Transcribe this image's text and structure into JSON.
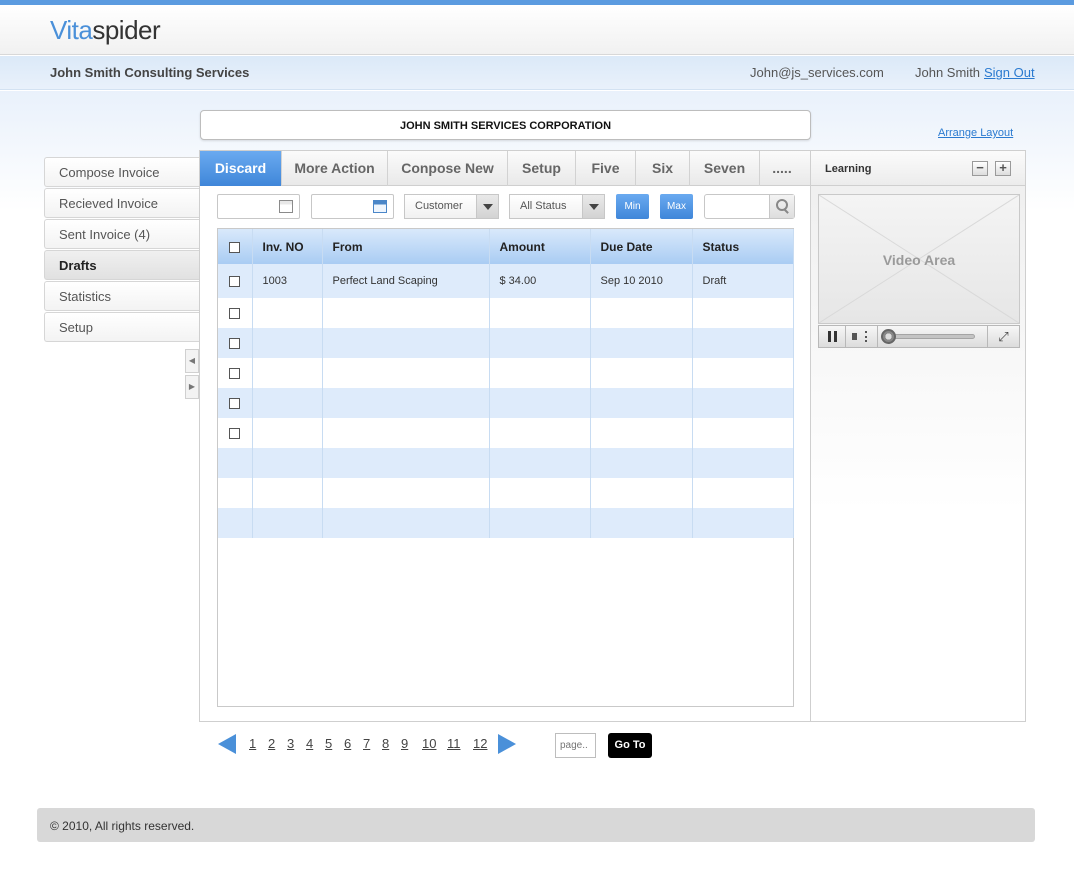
{
  "app": {
    "logo_part1": "Vita",
    "logo_part2": "spider"
  },
  "subheader": {
    "company": "John Smith Consulting Services",
    "email": "John@js_services.com",
    "user": "John Smith",
    "sign_out": "Sign Out"
  },
  "corp_title": "JOHN SMITH SERVICES CORPORATION",
  "arrange_layout": "Arrange Layout",
  "sidebar": {
    "items": [
      {
        "label": "Compose Invoice",
        "active": false
      },
      {
        "label": "Recieved Invoice",
        "active": false
      },
      {
        "label": "Sent Invoice (4)",
        "active": false
      },
      {
        "label": "Drafts",
        "active": true
      },
      {
        "label": "Statistics",
        "active": false
      },
      {
        "label": "Setup",
        "active": false
      }
    ]
  },
  "tabs": [
    {
      "label": "Discard",
      "active": true
    },
    {
      "label": "More Action",
      "active": false
    },
    {
      "label": "Conpose New",
      "active": false
    },
    {
      "label": "Setup",
      "active": false
    },
    {
      "label": "Five",
      "active": false
    },
    {
      "label": "Six",
      "active": false
    },
    {
      "label": "Seven",
      "active": false
    },
    {
      "label": ".....",
      "active": false
    }
  ],
  "filters": {
    "customer": "Customer",
    "status": "All Status",
    "min": "Min",
    "max": "Max"
  },
  "table": {
    "headers": [
      "Inv. NO",
      "From",
      "Amount",
      "Due Date",
      "Status"
    ],
    "rows": [
      {
        "inv": "1003",
        "from": "Perfect Land Scaping",
        "amount": "$ 34.00",
        "due": "Sep 10 2010",
        "status": "Draft"
      }
    ]
  },
  "side_panel": {
    "title": "Learning",
    "minimize": "−",
    "maximize": "+",
    "video_label": "Video Area"
  },
  "pager": {
    "pages": [
      "1",
      "2",
      "3",
      "4",
      "5",
      "6",
      "7",
      "8",
      "9",
      "10",
      "11",
      "12"
    ],
    "page_placeholder": "page..",
    "goto": "Go To"
  },
  "footer": "© 2010, All rights reserved.",
  "colors": {
    "accent": "#4a90d9",
    "tab_active": "#3f86d9",
    "row_alt": "#deebfb"
  }
}
